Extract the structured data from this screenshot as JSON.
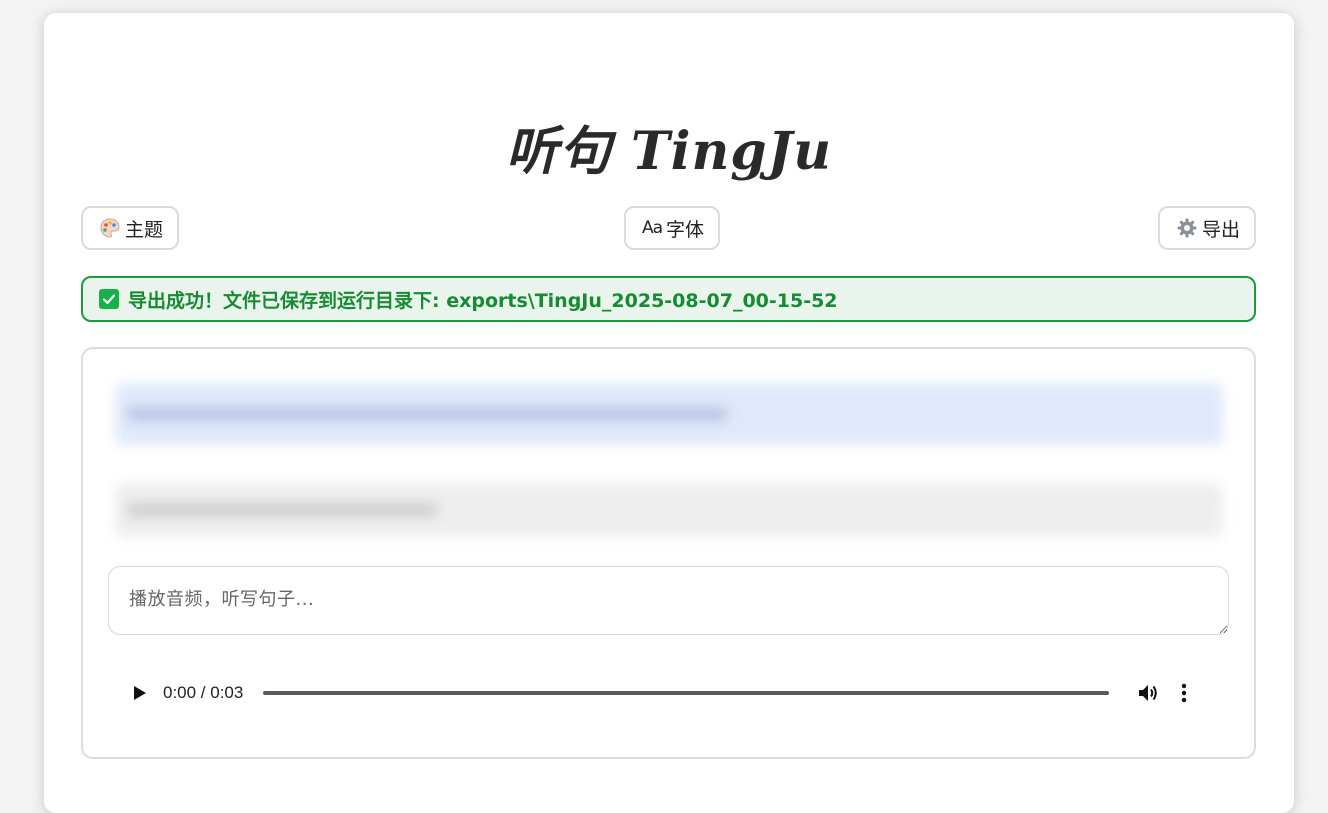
{
  "app": {
    "title": "听句 TingJu"
  },
  "toolbar": {
    "theme_label": "主题",
    "font_icon_text": "Aa",
    "font_label": "字体",
    "export_label": "导出"
  },
  "alert": {
    "message": "导出成功！文件已保存到运行目录下: exports\\TingJu_2025-08-07_00-15-52",
    "color": "#188a33"
  },
  "dictation": {
    "placeholder": "播放音频，听写句子..."
  },
  "audio": {
    "time": "0:00 / 0:03",
    "progress": 0
  },
  "colors": {
    "accent_green": "#16b14a",
    "blur_blue": "#e0e9fb",
    "blur_gray": "#eeeeee"
  },
  "icons": {
    "theme": "palette-icon",
    "font": "font-size-icon",
    "export": "gear-icon",
    "alert": "check-icon"
  }
}
